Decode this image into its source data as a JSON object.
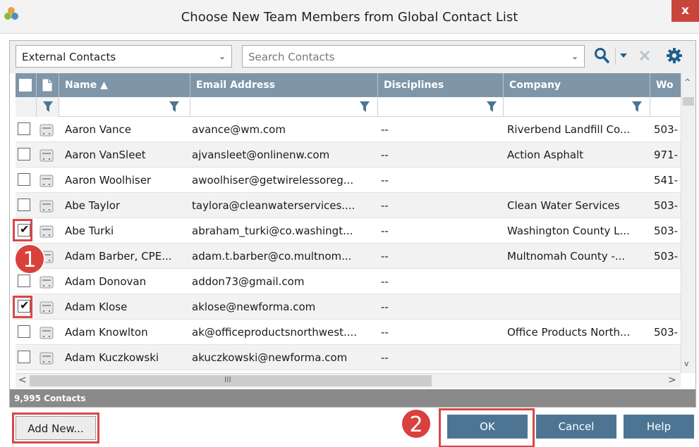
{
  "window": {
    "title": "Choose New Team Members from Global Contact List",
    "close_label": "x"
  },
  "toolbar": {
    "source_value": "External Contacts",
    "search_placeholder": "Search Contacts"
  },
  "columns": {
    "name": "Name ▲",
    "email": "Email Address",
    "disciplines": "Disciplines",
    "company": "Company",
    "work": "Wo"
  },
  "rows": [
    {
      "checked": false,
      "name": "Aaron Vance",
      "email": "avance@wm.com",
      "disciplines": "--",
      "company": "Riverbend Landfill Co...",
      "work": "503-"
    },
    {
      "checked": false,
      "name": "Aaron VanSleet",
      "email": "ajvansleet@onlinenw.com",
      "disciplines": "--",
      "company": "Action Asphalt",
      "work": "971-"
    },
    {
      "checked": false,
      "name": "Aaron Woolhiser",
      "email": "awoolhiser@getwirelessoreg...",
      "disciplines": "--",
      "company": "",
      "work": "541-"
    },
    {
      "checked": false,
      "name": "Abe Taylor",
      "email": "taylora@cleanwaterservices....",
      "disciplines": "--",
      "company": "Clean Water Services",
      "work": "503-"
    },
    {
      "checked": true,
      "name": "Abe Turki",
      "email": "abraham_turki@co.washingt...",
      "disciplines": "--",
      "company": "Washington County L...",
      "work": "503-"
    },
    {
      "checked": false,
      "name": "Adam Barber, CPE...",
      "email": "adam.t.barber@co.multnom...",
      "disciplines": "--",
      "company": "Multnomah County -...",
      "work": "503-"
    },
    {
      "checked": false,
      "name": "Adam Donovan",
      "email": "addon73@gmail.com",
      "disciplines": "--",
      "company": "",
      "work": ""
    },
    {
      "checked": true,
      "name": "Adam Klose",
      "email": "aklose@newforma.com",
      "disciplines": "--",
      "company": "",
      "work": ""
    },
    {
      "checked": false,
      "name": "Adam Knowlton",
      "email": "ak@officeproductsnorthwest....",
      "disciplines": "--",
      "company": "Office Products North...",
      "work": "503-"
    },
    {
      "checked": false,
      "name": "Adam Kuczkowski",
      "email": "akuczkowski@newforma.com",
      "disciplines": "--",
      "company": "",
      "work": ""
    }
  ],
  "status": {
    "count": "9,995 Contacts"
  },
  "buttons": {
    "add_new": "Add New...",
    "ok": "OK",
    "cancel": "Cancel",
    "help": "Help"
  },
  "callouts": {
    "one": "1",
    "two": "2"
  },
  "scroll": {
    "left_arrow": "<",
    "right_arrow": ">",
    "up_arrow": "^",
    "down_arrow": "v",
    "grip": "III"
  },
  "colors": {
    "header_bg": "#7f96a8",
    "primary_button": "#4d7593",
    "highlight": "#d94747"
  }
}
